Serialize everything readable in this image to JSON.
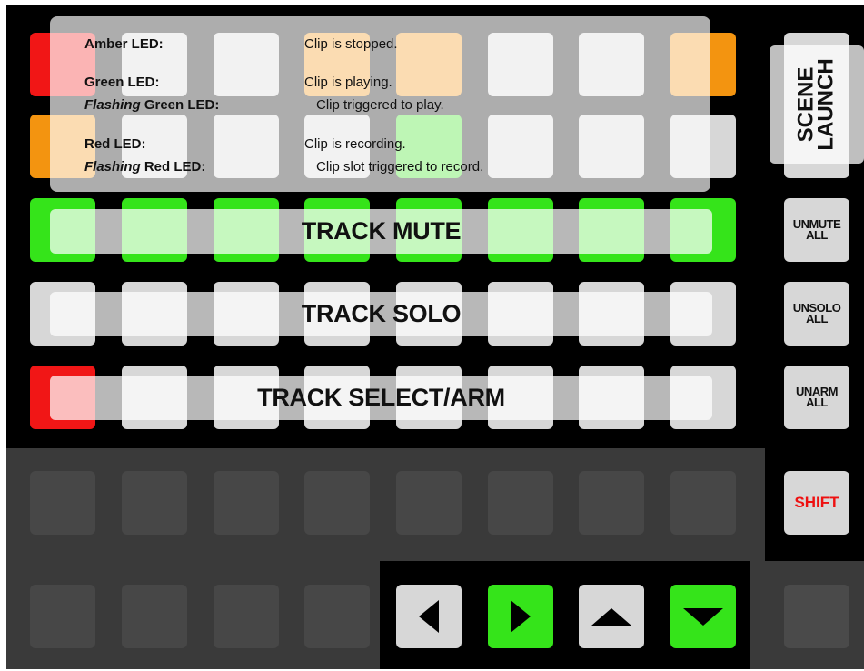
{
  "legend": {
    "rows": [
      {
        "led": "Amber LED:",
        "desc": "Clip is stopped."
      },
      {
        "led": "Green LED:",
        "desc": "Clip is playing."
      },
      {
        "led_prefix": "Flashing",
        "led": " Green LED:",
        "desc": "Clip triggered to play."
      },
      {
        "led": "Red LED:",
        "desc": "Clip is recording."
      },
      {
        "led_prefix": "Flashing",
        "led": " Red LED:",
        "desc": "Clip slot triggered to record."
      }
    ]
  },
  "bars": {
    "track_mute": "TRACK MUTE",
    "track_solo": "TRACK SOLO",
    "track_select_arm": "TRACK SELECT/ARM"
  },
  "side_buttons": {
    "scene_launch_1": "SCENE",
    "scene_launch_2": "LAUNCH",
    "unmute_1": "UNMUTE",
    "unmute_2": "ALL",
    "unsolo_1": "UNSOLO",
    "unsolo_2": "ALL",
    "unarm_1": "UNARM",
    "unarm_2": "ALL",
    "shift": "SHIFT"
  },
  "colors": {
    "led_green": "#35e41a",
    "led_red": "#f11616",
    "led_amber": "#f39410",
    "pad_off": "#d7d7d7",
    "shift_text": "#ee1111"
  },
  "icons": [
    "arrow-left-icon",
    "arrow-right-icon",
    "arrow-up-icon",
    "arrow-down-icon"
  ]
}
